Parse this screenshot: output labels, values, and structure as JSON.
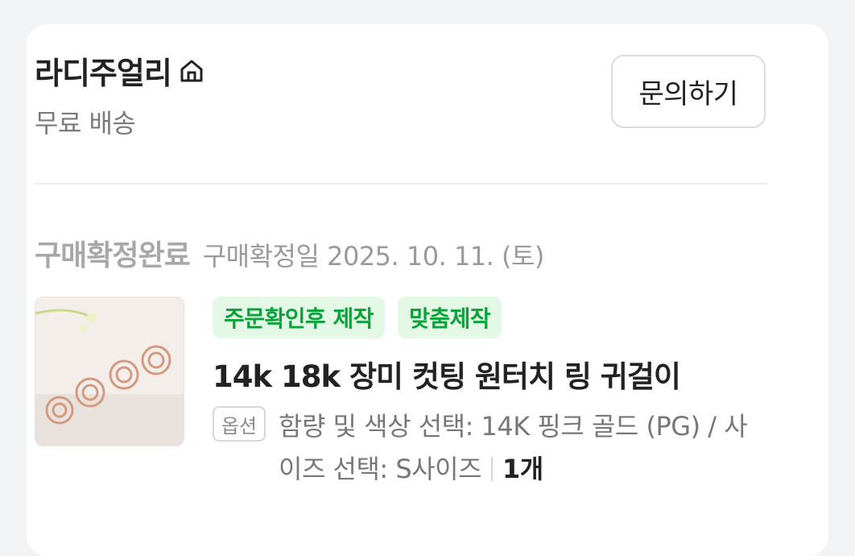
{
  "store": {
    "name": "라디주얼리",
    "home_icon": "home-icon",
    "shipping": "무료 배송",
    "inquiry_label": "문의하기"
  },
  "order": {
    "status": "구매확정완료",
    "confirm_date": "구매확정일 2025. 10. 11. (토)",
    "tags": [
      "주문확인후 제작",
      "맞춤제작"
    ],
    "product_name": "14k 18k 장미 컷팅 원터치 링 귀걸이",
    "option_label": "옵션",
    "option_text": "함량 및 색상 선택: 14K 핑크 골드 (PG) / 사이즈 선택: S사이즈",
    "quantity": "1개"
  },
  "colors": {
    "tag_bg": "#e3f8e5",
    "tag_text": "#0aa33a",
    "status_text": "#a8a8a8"
  }
}
